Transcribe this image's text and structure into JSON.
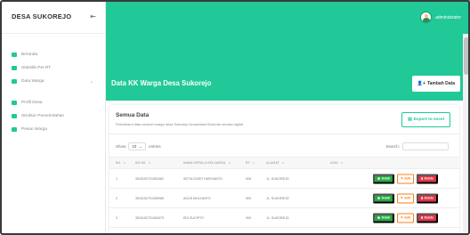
{
  "app": {
    "brand": "DESA SUKOREJO",
    "user": "administrator"
  },
  "colors": {
    "accent": "#20c997",
    "detail": "#28a745",
    "edit": "#fd7e14",
    "delete": "#dc3545"
  },
  "sidebar": {
    "items": [
      {
        "label": "Beranda",
        "icon": "dashboard-icon",
        "color": "#20c997"
      },
      {
        "label": "Statistik Per RT",
        "icon": "chart-icon",
        "color": "#20c997"
      },
      {
        "label": "Data Warga",
        "icon": "users-icon",
        "color": "#20c997",
        "has_submenu": true
      },
      {
        "label": "Profil Desa",
        "icon": "building-icon",
        "color": "#20c997"
      },
      {
        "label": "Struktur Pemerintahan",
        "icon": "sitemap-icon",
        "color": "#20c997"
      },
      {
        "label": "Pesan Warga",
        "icon": "mail-icon",
        "color": "#20c997"
      }
    ]
  },
  "page": {
    "title": "Data KK Warga Desa Sukorejo",
    "add_button": "Tambah Data"
  },
  "card": {
    "title": "Semua Data",
    "subtitle": "Perbaharui data seluruh warga desa Sukorejo kecamatan Buduran secara digital",
    "export_button": "Export to excel"
  },
  "table": {
    "show_label": "Show",
    "entries_value": "10",
    "entries_label": "entries",
    "search_label": "Search:",
    "columns": {
      "no": "NO",
      "kk": "NO KK",
      "nama": "NAMA KEPALA KELUARGA",
      "rt": "RT",
      "alamat": "ALAMAT",
      "aksi": "AKSI"
    },
    "rows": [
      {
        "no": "1",
        "kk": "3515152701081962",
        "nama": "SETIA DODIT HARIYANTO",
        "rt": "006",
        "alamat": "JL. SUKOREJO"
      },
      {
        "no": "2",
        "kk": "3515152701080985",
        "nama": "AGUS MULYANTO",
        "rt": "009",
        "alamat": "JL. SUKOREJO"
      },
      {
        "no": "3",
        "kk": "3515152701081675",
        "nama": "EDI SUCIPTO",
        "rt": "009",
        "alamat": "JL. SUKOREJO"
      }
    ],
    "actions": {
      "detail": "Detail",
      "edit": "Edit",
      "delete": "Delete"
    }
  }
}
